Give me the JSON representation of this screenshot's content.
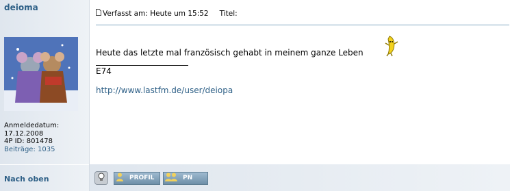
{
  "author": {
    "username": "deioma",
    "meta_line1": "Anmeldedatum:",
    "meta_line2": "17.12.2008",
    "meta_line3": "4P ID: 801478",
    "posts": "Beiträge: 1035",
    "back_to_top": "Nach oben"
  },
  "post": {
    "posted_label": "Verfasst am: Heute um 15:52",
    "title_label": "Titel:",
    "message": "Heute das letzte mal französisch gehabt in meinem ganze Leben",
    "signature_text": "E74",
    "link": "http://www.lastfm.de/user/deiopa"
  },
  "buttons": {
    "profile": "PROFIL",
    "pm": "PN"
  }
}
